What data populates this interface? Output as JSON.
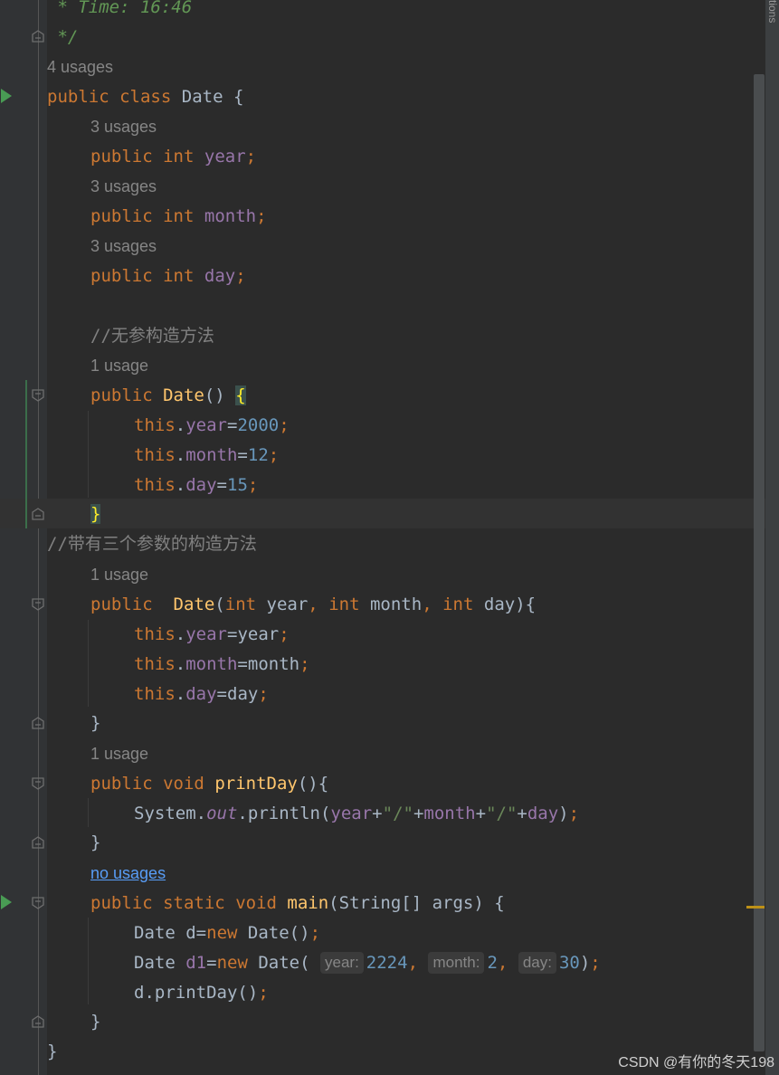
{
  "side_tab_label": "tions",
  "header": {
    "comment_time": " * Time: 16:46",
    "comment_end": " */"
  },
  "usages": {
    "class": "4 usages",
    "year": "3 usages",
    "month": "3 usages",
    "day": "3 usages",
    "ctor_noarg": "1 usage",
    "ctor_3arg": "1 usage",
    "printDay": "1 usage",
    "main": "no usages"
  },
  "comments": {
    "noarg": "//无参构造方法",
    "threearg": "//带有三个参数的构造方法"
  },
  "code": {
    "kw_public": "public",
    "kw_class": "class",
    "kw_int": "int",
    "kw_this": "this",
    "kw_void": "void",
    "kw_static": "static",
    "kw_new": "new",
    "class_name": "Date",
    "field_year": "year",
    "field_month": "month",
    "field_day": "day",
    "val_year": "2000",
    "val_month": "12",
    "val_day": "15",
    "method_printDay": "printDay",
    "method_main": "main",
    "system": "System",
    "out": "out",
    "println": "println",
    "slash_str": "\"/\"",
    "string_type": "String[]",
    "args": "args",
    "var_d": "d",
    "var_d1": "d1",
    "arg_year": "2224",
    "arg_month": "2",
    "arg_day": "30"
  },
  "param_hints": {
    "year": "year:",
    "month": "month:",
    "day": "day:"
  },
  "watermark": "CSDN @有你的冬天198",
  "colors": {
    "background": "#2b2b2b",
    "keyword": "#cc7832",
    "field": "#9876aa",
    "number": "#6897bb",
    "string": "#6a8759",
    "method": "#ffc66d",
    "comment": "#808080",
    "doc_comment": "#629755",
    "text": "#a9b7c6",
    "run_icon": "#499c54"
  },
  "icons": [
    "run-icon",
    "fold-icon"
  ]
}
